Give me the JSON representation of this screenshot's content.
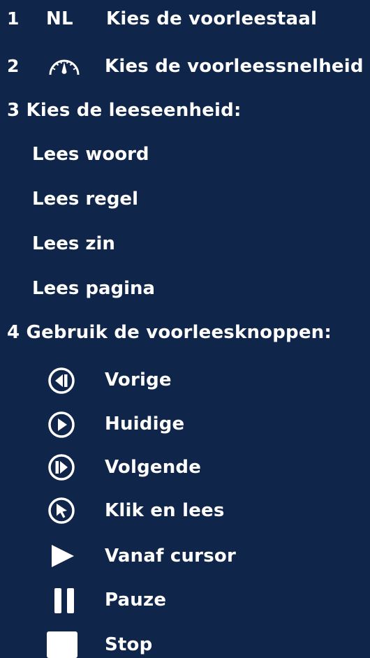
{
  "steps": {
    "s1": {
      "number": "1",
      "badge": "NL",
      "label": "Kies de voorleestaal"
    },
    "s2": {
      "number": "2",
      "icon": "speedometer-icon",
      "label": "Kies de voorleessnelheid"
    },
    "s3": {
      "label": "3  Kies de leeseenheid:",
      "options": [
        "Lees woord",
        "Lees regel",
        "Lees zin",
        "Lees pagina"
      ]
    },
    "s4": {
      "label": "4  Gebruik de voorleesknoppen:",
      "buttons": [
        {
          "icon": "previous-icon",
          "label": "Vorige"
        },
        {
          "icon": "current-play-icon",
          "label": "Huidige"
        },
        {
          "icon": "next-icon",
          "label": "Volgende"
        },
        {
          "icon": "click-and-read-icon",
          "label": "Klik en lees"
        },
        {
          "icon": "play-icon",
          "label": "Vanaf cursor"
        },
        {
          "icon": "pause-icon",
          "label": "Pauze"
        },
        {
          "icon": "stop-icon",
          "label": "Stop"
        }
      ]
    }
  },
  "colors": {
    "background": "#0f264a",
    "foreground": "#ffffff"
  }
}
